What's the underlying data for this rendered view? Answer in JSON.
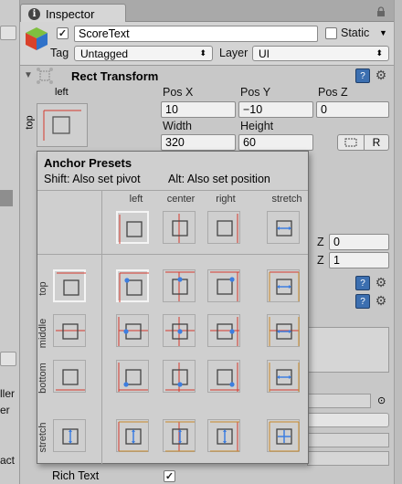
{
  "tab": {
    "title": "Inspector",
    "icon": "info-icon"
  },
  "header": {
    "enabled": true,
    "object_name": "ScoreText",
    "static_label": "Static",
    "tag_label": "Tag",
    "tag_value": "Untagged",
    "layer_label": "Layer",
    "layer_value": "UI"
  },
  "rect_transform": {
    "title": "Rect Transform",
    "anchor_h_label": "left",
    "anchor_v_label": "top",
    "pos_x_label": "Pos X",
    "pos_y_label": "Pos Y",
    "pos_z_label": "Pos Z",
    "pos_x": "10",
    "pos_y": "−10",
    "pos_z": "0",
    "width_label": "Width",
    "height_label": "Height",
    "width": "320",
    "height": "60",
    "raw_label": "R"
  },
  "scale_rows": [
    {
      "axis": "Z",
      "value": "0"
    },
    {
      "axis": "Z",
      "value": "1"
    }
  ],
  "anchor_presets": {
    "title": "Anchor Presets",
    "hint_shift": "Shift: Also set pivot",
    "hint_alt": "Alt: Also set position",
    "columns": [
      "left",
      "center",
      "right",
      "stretch"
    ],
    "rows": [
      "top",
      "middle",
      "bottom",
      "stretch"
    ],
    "selected": {
      "row": "top",
      "column": "left"
    }
  },
  "left_panel_texts": [
    "ller",
    "er",
    "act"
  ],
  "rich_text": {
    "label": "Rich Text",
    "checked": true
  },
  "colors": {
    "anchor_red": "#d43a2e",
    "pivot_blue": "#3d7ee0",
    "stretch_orange": "#c88a2a"
  }
}
